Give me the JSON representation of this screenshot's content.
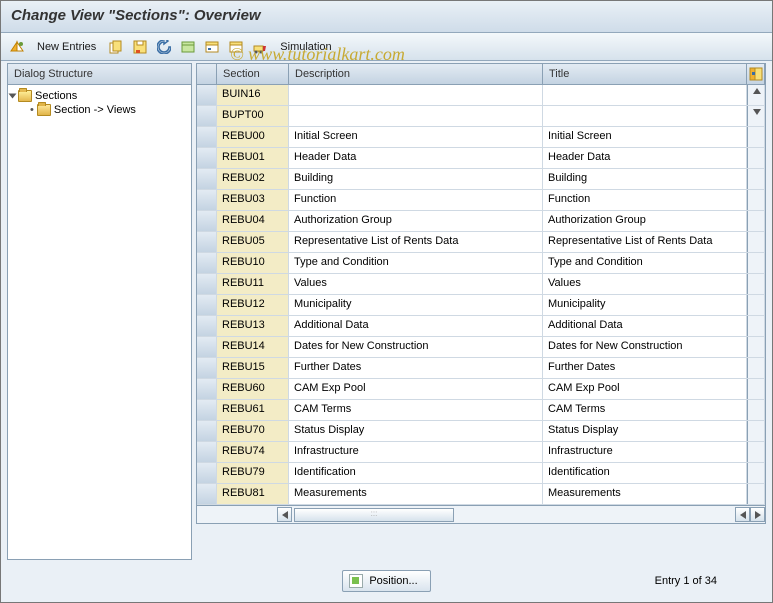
{
  "header": {
    "title": "Change View \"Sections\": Overview"
  },
  "toolbar": {
    "new_entries": "New Entries",
    "simulation": "Simulation"
  },
  "dialog": {
    "title": "Dialog Structure",
    "node1": "Sections",
    "node2": "Section -> Views"
  },
  "columns": {
    "section": "Section",
    "description": "Description",
    "title": "Title"
  },
  "rows": [
    {
      "sect": "BUIN16",
      "desc": "",
      "title": ""
    },
    {
      "sect": "BUPT00",
      "desc": "",
      "title": ""
    },
    {
      "sect": "REBU00",
      "desc": "Initial Screen",
      "title": "Initial Screen"
    },
    {
      "sect": "REBU01",
      "desc": "Header Data",
      "title": "Header Data"
    },
    {
      "sect": "REBU02",
      "desc": "Building",
      "title": "Building"
    },
    {
      "sect": "REBU03",
      "desc": "Function",
      "title": "Function"
    },
    {
      "sect": "REBU04",
      "desc": "Authorization Group",
      "title": "Authorization Group"
    },
    {
      "sect": "REBU05",
      "desc": "Representative List of Rents Data",
      "title": "Representative List of Rents Data"
    },
    {
      "sect": "REBU10",
      "desc": "Type and Condition",
      "title": "Type and Condition"
    },
    {
      "sect": "REBU11",
      "desc": "Values",
      "title": "Values"
    },
    {
      "sect": "REBU12",
      "desc": "Municipality",
      "title": "Municipality"
    },
    {
      "sect": "REBU13",
      "desc": "Additional Data",
      "title": "Additional Data"
    },
    {
      "sect": "REBU14",
      "desc": "Dates for New Construction",
      "title": "Dates for New Construction"
    },
    {
      "sect": "REBU15",
      "desc": "Further Dates",
      "title": "Further Dates"
    },
    {
      "sect": "REBU60",
      "desc": "CAM Exp Pool",
      "title": "CAM Exp Pool"
    },
    {
      "sect": "REBU61",
      "desc": "CAM Terms",
      "title": "CAM Terms"
    },
    {
      "sect": "REBU70",
      "desc": "Status Display",
      "title": "Status Display"
    },
    {
      "sect": "REBU74",
      "desc": "Infrastructure",
      "title": "Infrastructure"
    },
    {
      "sect": "REBU79",
      "desc": "Identification",
      "title": "Identification"
    },
    {
      "sect": "REBU81",
      "desc": "Measurements",
      "title": "Measurements"
    }
  ],
  "footer": {
    "position": "Position...",
    "entry": "Entry 1 of 34"
  },
  "watermark": "© www.tutorialkart.com"
}
